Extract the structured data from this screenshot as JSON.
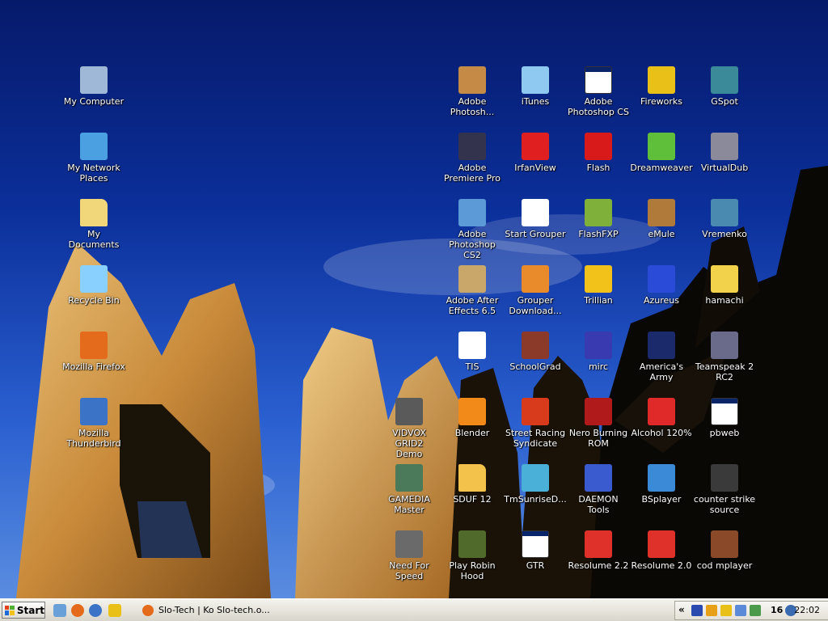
{
  "desktop_icons": [
    {
      "label": "My Computer",
      "icon": "computer-icon",
      "color": "#9fb8d8"
    },
    {
      "label": "My Network\nPlaces",
      "icon": "network-places-icon",
      "color": "#4aa0e0"
    },
    {
      "label": "My Documents",
      "icon": "folder-documents-icon",
      "color": "#f1d77a"
    },
    {
      "label": "Recycle Bin",
      "icon": "recycle-bin-icon",
      "color": "#8ad0ff"
    },
    {
      "label": "Mozilla Firefox",
      "icon": "firefox-icon",
      "color": "#e46a1c"
    },
    {
      "label": "Mozilla\nThunderbird",
      "icon": "thunderbird-icon",
      "color": "#3b74c7"
    },
    {
      "label": "Adobe\nPhotosh...",
      "icon": "camera-icon",
      "color": "#c58b46"
    },
    {
      "label": "Adobe\nPremiere Pro",
      "icon": "premiere-icon",
      "color": "#33334d"
    },
    {
      "label": "Adobe\nPhotoshop CS2",
      "icon": "photoshop-feather-icon",
      "color": "#5b9ad6"
    },
    {
      "label": "Adobe After\nEffects 6.5",
      "icon": "after-effects-icon",
      "color": "#c9a66a"
    },
    {
      "label": "TIS",
      "icon": "tis-bird-icon",
      "color": "#ffffff"
    },
    {
      "label": "Blender",
      "icon": "blender-icon",
      "color": "#f28a19"
    },
    {
      "label": "SDUF 12",
      "icon": "folder-icon",
      "color": "#f2c24a"
    },
    {
      "label": "Play Robin\nHood",
      "icon": "robin-hood-icon",
      "color": "#4f6a2a"
    },
    {
      "label": "iTunes",
      "icon": "itunes-icon",
      "color": "#8fc8f0"
    },
    {
      "label": "IrfanView",
      "icon": "irfanview-icon",
      "color": "#e02020"
    },
    {
      "label": "Start Grouper",
      "icon": "grouper-icon",
      "color": "#ffffff"
    },
    {
      "label": "Grouper\nDownload...",
      "icon": "grouper-download-icon",
      "color": "#e98b2a"
    },
    {
      "label": "SchoolGrad",
      "icon": "books-icon",
      "color": "#8b3a2a"
    },
    {
      "label": "Street Racing\nSyndicate",
      "icon": "srs-icon",
      "color": "#d83b1c"
    },
    {
      "label": "TmSunriseD...",
      "icon": "trackmania-icon",
      "color": "#4ab0d8"
    },
    {
      "label": "GTR",
      "icon": "window-icon",
      "color": "#ffffff"
    },
    {
      "label": "Adobe\nPhotoshop CS",
      "icon": "window-icon",
      "color": "#ffffff"
    },
    {
      "label": "Flash",
      "icon": "flash-icon",
      "color": "#d91a1a"
    },
    {
      "label": "FlashFXP",
      "icon": "flashfxp-icon",
      "color": "#7fb03a"
    },
    {
      "label": "Trillian",
      "icon": "trillian-icon",
      "color": "#f2c21a"
    },
    {
      "label": "mirc",
      "icon": "mirc-icon",
      "color": "#3a3ab0"
    },
    {
      "label": "Nero Burning\nROM",
      "icon": "nero-icon",
      "color": "#b01a1a"
    },
    {
      "label": "DAEMON Tools",
      "icon": "daemon-tools-icon",
      "color": "#3a5ad0"
    },
    {
      "label": "Resolume 2.2",
      "icon": "resolume-icon",
      "color": "#e0302a"
    },
    {
      "label": "Fireworks",
      "icon": "fireworks-icon",
      "color": "#e8c018"
    },
    {
      "label": "Dreamweaver",
      "icon": "dreamweaver-icon",
      "color": "#5fbf3a"
    },
    {
      "label": "eMule",
      "icon": "emule-icon",
      "color": "#b07a3a"
    },
    {
      "label": "Azureus",
      "icon": "azureus-frog-icon",
      "color": "#2a4ad8"
    },
    {
      "label": "America's Army",
      "icon": "americas-army-icon",
      "color": "#1a2a6a"
    },
    {
      "label": "Alcohol 120%",
      "icon": "alcohol-icon",
      "color": "#e02a2a"
    },
    {
      "label": "BSplayer",
      "icon": "bsplayer-icon",
      "color": "#3a8ad8"
    },
    {
      "label": "Resolume 2.0",
      "icon": "resolume-icon",
      "color": "#e0302a"
    },
    {
      "label": "GSpot",
      "icon": "gspot-icon",
      "color": "#3a8a9a"
    },
    {
      "label": "VirtualDub",
      "icon": "virtualdub-icon",
      "color": "#8a8a9a"
    },
    {
      "label": "Vremenko",
      "icon": "vremenko-icon",
      "color": "#4a8ab0"
    },
    {
      "label": "hamachi",
      "icon": "hamachi-icon",
      "color": "#f2d24a"
    },
    {
      "label": "Teamspeak 2\nRC2",
      "icon": "teamspeak-icon",
      "color": "#6a6a8a"
    },
    {
      "label": "pbweb",
      "icon": "window-icon",
      "color": "#ffffff"
    },
    {
      "label": "counter strike\nsource",
      "icon": "counter-strike-icon",
      "color": "#3a3a3a"
    },
    {
      "label": "cod mplayer",
      "icon": "cod-star-icon",
      "color": "#8a4a2a"
    },
    {
      "label": "VIDVOX GRID2\nDemo",
      "icon": "vidvox-grid-icon",
      "color": "#5a5a5a"
    },
    {
      "label": "GAMEDIA\nMaster",
      "icon": "gamedia-icon",
      "color": "#4a7a5a"
    },
    {
      "label": "Need For\nSpeed",
      "icon": "nfs-icon",
      "color": "#6a6a6a"
    }
  ],
  "taskbar": {
    "start_label": "Start",
    "task_title": "Slo-Tech | Ko Slo-tech.o...",
    "tray_chevron": "«",
    "tray_number": "16",
    "clock": "22:02"
  }
}
